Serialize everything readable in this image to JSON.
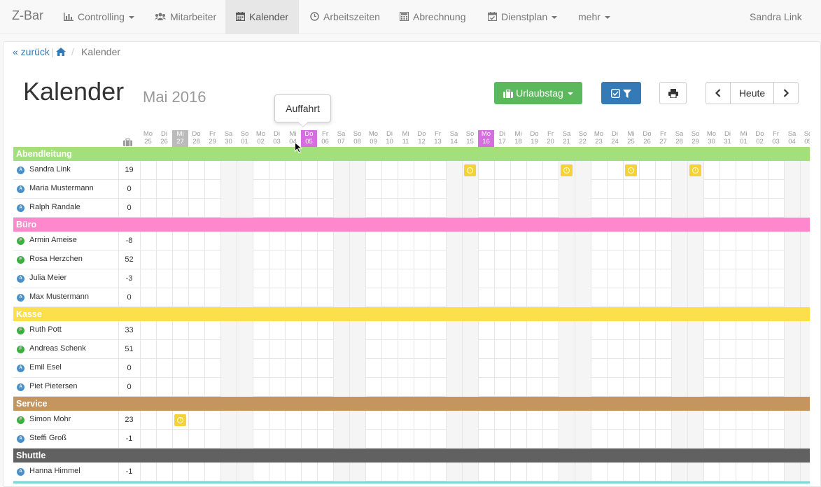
{
  "nav": {
    "brand": "Z-Bar",
    "items": [
      {
        "label": "Controlling",
        "icon": "bar-chart-icon",
        "dropdown": true
      },
      {
        "label": "Mitarbeiter",
        "icon": "users-icon",
        "dropdown": false
      },
      {
        "label": "Kalender",
        "icon": "calendar-icon",
        "dropdown": false,
        "active": true
      },
      {
        "label": "Arbeitszeiten",
        "icon": "clock-icon",
        "dropdown": false
      },
      {
        "label": "Abrechnung",
        "icon": "calculator-icon",
        "dropdown": false
      },
      {
        "label": "Dienstplan",
        "icon": "calendar-check-icon",
        "dropdown": true
      },
      {
        "label": "mehr",
        "icon": "",
        "dropdown": true
      }
    ],
    "user": "Sandra Link"
  },
  "breadcrumb": {
    "back": "« zurück",
    "current": "Kalender"
  },
  "page": {
    "title": "Kalender",
    "subtitle": "Mai 2016"
  },
  "toolbar": {
    "vacation_label": "Urlaubstag",
    "today_label": "Heute"
  },
  "tooltip": {
    "text": "Auffahrt"
  },
  "colors": {
    "Abendleitung": "#a3e07b",
    "Büro": "#ff88cc",
    "Kasse": "#fbe04c",
    "Service": "#c4955f",
    "Shuttle": "#616161",
    "holiday": "#d66de0",
    "event": "#f3d23a"
  },
  "days": [
    {
      "wd": "Mo",
      "d": "25"
    },
    {
      "wd": "Di",
      "d": "26"
    },
    {
      "wd": "Mi",
      "d": "27",
      "today": true
    },
    {
      "wd": "Do",
      "d": "28"
    },
    {
      "wd": "Fr",
      "d": "29"
    },
    {
      "wd": "Sa",
      "d": "30"
    },
    {
      "wd": "So",
      "d": "01"
    },
    {
      "wd": "Mo",
      "d": "02"
    },
    {
      "wd": "Di",
      "d": "03"
    },
    {
      "wd": "Mi",
      "d": "04"
    },
    {
      "wd": "Do",
      "d": "05",
      "holiday": true
    },
    {
      "wd": "Fr",
      "d": "06"
    },
    {
      "wd": "Sa",
      "d": "07"
    },
    {
      "wd": "So",
      "d": "08"
    },
    {
      "wd": "Mo",
      "d": "09"
    },
    {
      "wd": "Di",
      "d": "10"
    },
    {
      "wd": "Mi",
      "d": "11"
    },
    {
      "wd": "Do",
      "d": "12"
    },
    {
      "wd": "Fr",
      "d": "13"
    },
    {
      "wd": "Sa",
      "d": "14"
    },
    {
      "wd": "So",
      "d": "15"
    },
    {
      "wd": "Mo",
      "d": "16",
      "holiday": true
    },
    {
      "wd": "Di",
      "d": "17"
    },
    {
      "wd": "Mi",
      "d": "18"
    },
    {
      "wd": "Do",
      "d": "19"
    },
    {
      "wd": "Fr",
      "d": "20"
    },
    {
      "wd": "Sa",
      "d": "21"
    },
    {
      "wd": "So",
      "d": "22"
    },
    {
      "wd": "Mo",
      "d": "23"
    },
    {
      "wd": "Di",
      "d": "24"
    },
    {
      "wd": "Mi",
      "d": "25"
    },
    {
      "wd": "Do",
      "d": "26"
    },
    {
      "wd": "Fr",
      "d": "27"
    },
    {
      "wd": "Sa",
      "d": "28"
    },
    {
      "wd": "So",
      "d": "29"
    },
    {
      "wd": "Mo",
      "d": "30"
    },
    {
      "wd": "Di",
      "d": "31"
    },
    {
      "wd": "Mi",
      "d": "01"
    },
    {
      "wd": "Do",
      "d": "02"
    },
    {
      "wd": "Fr",
      "d": "03"
    },
    {
      "wd": "Sa",
      "d": "04"
    },
    {
      "wd": "So",
      "d": "05"
    }
  ],
  "groups": [
    {
      "name": "Abendleitung",
      "employees": [
        {
          "name": "Sandra Link",
          "type": "A",
          "count": "19",
          "events": [
            20,
            26,
            30,
            34
          ]
        },
        {
          "name": "Maria Mustermann",
          "type": "A",
          "count": "0",
          "events": []
        },
        {
          "name": "Ralph Randale",
          "type": "A",
          "count": "0",
          "events": []
        }
      ]
    },
    {
      "name": "Büro",
      "employees": [
        {
          "name": "Armin Ameise",
          "type": "F",
          "count": "-8",
          "events": []
        },
        {
          "name": "Rosa Herzchen",
          "type": "F",
          "count": "52",
          "events": []
        },
        {
          "name": "Julia Meier",
          "type": "A",
          "count": "-3",
          "events": []
        },
        {
          "name": "Max Mustermann",
          "type": "A",
          "count": "0",
          "events": []
        }
      ]
    },
    {
      "name": "Kasse",
      "employees": [
        {
          "name": "Ruth Pott",
          "type": "F",
          "count": "33",
          "events": []
        },
        {
          "name": "Andreas Schenk",
          "type": "F",
          "count": "51",
          "events": []
        },
        {
          "name": "Emil Esel",
          "type": "A",
          "count": "0",
          "events": []
        },
        {
          "name": "Piet Pietersen",
          "type": "A",
          "count": "0",
          "events": []
        }
      ]
    },
    {
      "name": "Service",
      "employees": [
        {
          "name": "Simon Mohr",
          "type": "F",
          "count": "23",
          "events": [
            2
          ]
        },
        {
          "name": "Steffi Groß",
          "type": "A",
          "count": "-1",
          "events": []
        }
      ]
    },
    {
      "name": "Shuttle",
      "employees": [
        {
          "name": "Hanna Himmel",
          "type": "A",
          "count": "-1",
          "events": []
        }
      ]
    }
  ]
}
